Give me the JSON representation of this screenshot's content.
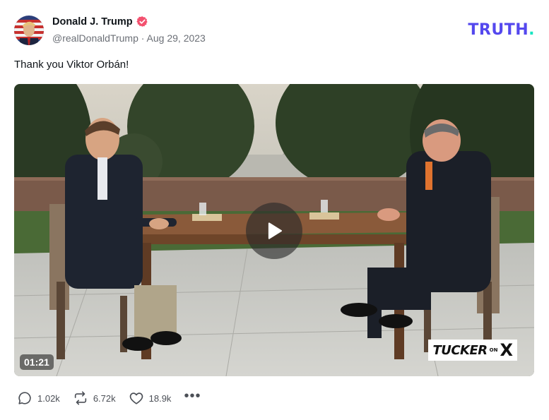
{
  "post": {
    "author_name": "Donald J. Trump",
    "handle": "@realDonaldTrump",
    "separator": "·",
    "date": "Aug 29, 2023",
    "text": "Thank you Viktor Orbán!"
  },
  "brand": {
    "logo_text": "TRUTH",
    "logo_dot": ".",
    "logo_color": "#5448ee",
    "dot_color": "#17e5c2"
  },
  "video": {
    "duration": "01:21",
    "watermark_name": "TUCKER",
    "watermark_on": "ON",
    "watermark_x": "X"
  },
  "actions": {
    "replies": "1.02k",
    "retruths": "6.72k",
    "likes": "18.9k",
    "more_glyph": "•••"
  },
  "icons": {
    "verified": "verified-badge-icon",
    "reply": "reply-bubble-icon",
    "retruth": "retruth-arrows-icon",
    "like": "heart-icon",
    "play": "play-icon",
    "more": "more-dots-icon"
  }
}
